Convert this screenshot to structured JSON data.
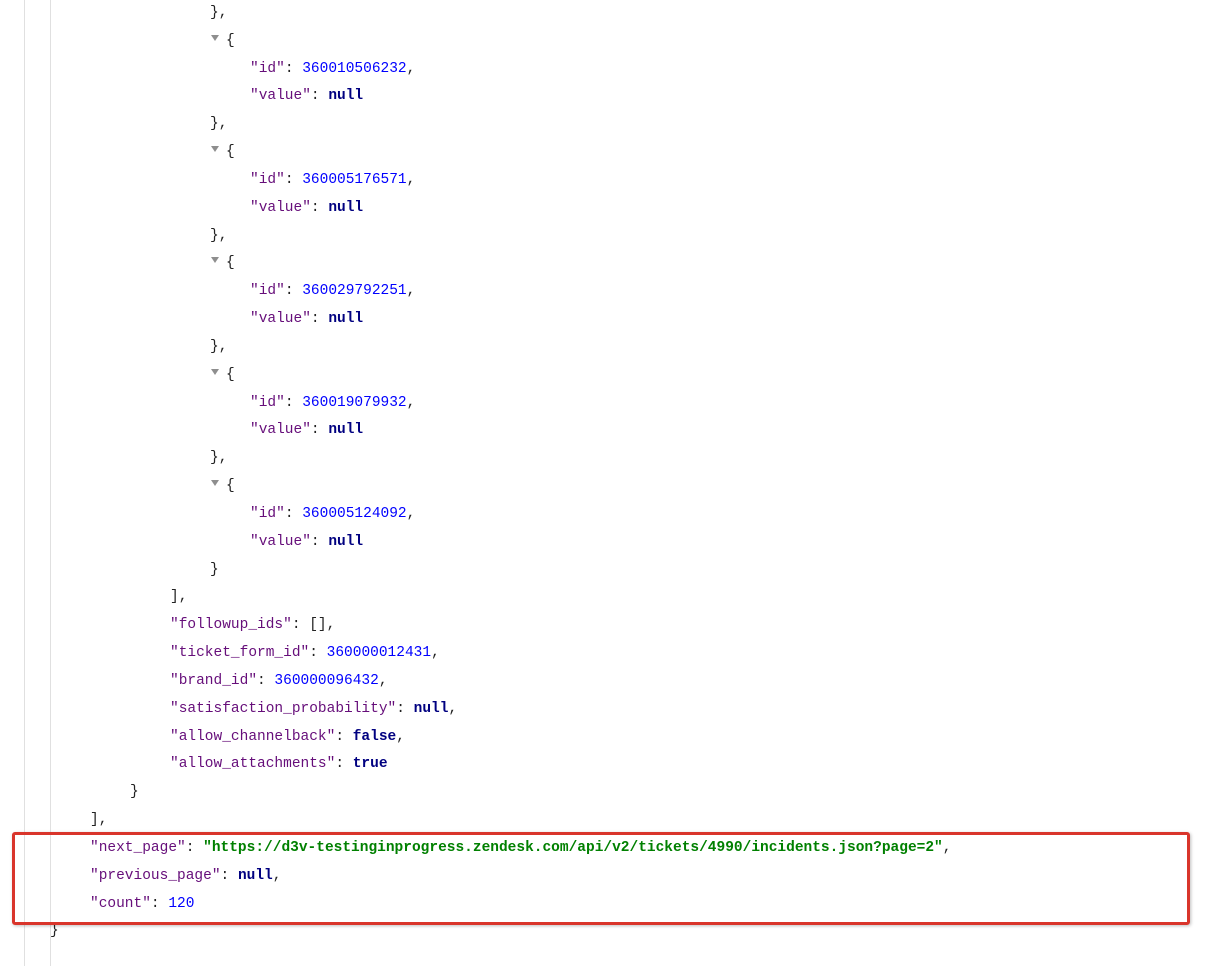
{
  "items": [
    {
      "id": 360010506232,
      "value": null
    },
    {
      "id": 360005176571,
      "value": null
    },
    {
      "id": 360029792251,
      "value": null
    },
    {
      "id": 360019079932,
      "value": null
    },
    {
      "id": 360005124092,
      "value": null
    }
  ],
  "after_block": {
    "followup_ids_label": "\"followup_ids\"",
    "followup_ids_val": "[]",
    "ticket_form_id_label": "\"ticket_form_id\"",
    "ticket_form_id_val": 360000012431,
    "brand_id_label": "\"brand_id\"",
    "brand_id_val": 360000096432,
    "sat_label": "\"satisfaction_probability\"",
    "sat_val": "null",
    "acb_label": "\"allow_channelback\"",
    "acb_val": "false",
    "aat_label": "\"allow_attachments\"",
    "aat_val": "true"
  },
  "pager": {
    "next_page_label": "\"next_page\"",
    "next_page_val": "\"https://d3v-testinginprogress.zendesk.com/api/v2/tickets/4990/incidents.json?page=2\"",
    "previous_page_label": "\"previous_page\"",
    "previous_page_val": "null",
    "count_label": "\"count\"",
    "count_val": 120
  },
  "labels": {
    "id": "\"id\"",
    "value": "\"value\"",
    "null": "null",
    "brace_open": "{",
    "brace_close": "}",
    "bracket_close": "]",
    "comma": ",",
    "colon": ": "
  }
}
